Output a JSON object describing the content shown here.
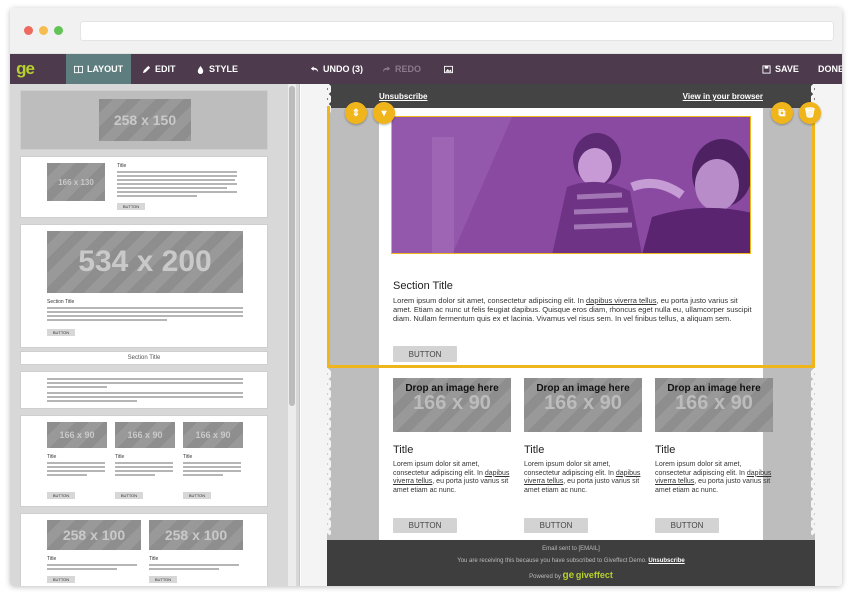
{
  "toolbar": {
    "logo": "ge",
    "layout": "LAYOUT",
    "edit": "EDIT",
    "style": "STYLE",
    "undo": "UNDO (3)",
    "redo": "REDO",
    "save": "SAVE",
    "done": "DONE"
  },
  "blocks": {
    "b1_ph": "258 x 150",
    "b2_ph": "166 x 130",
    "b2_title": "Title",
    "b2_btn": "BUTTON",
    "b3_ph": "534 x 200",
    "b3_title": "Section Title",
    "b3_btn": "BUTTON",
    "b4_title": "Section Title",
    "b6_ph": "166 x 90",
    "b6_title": "Title",
    "b6_btn": "BUTTON",
    "b7_ph": "258 x 100",
    "b7_title": "Title",
    "b7_btn": "BUTTON"
  },
  "email": {
    "unsubscribe": "Unsubscribe",
    "view_browser": "View in your browser",
    "section_title": "Section Title",
    "para_1": "Lorem ipsum dolor sit amet, consectetur adipiscing elit. In ",
    "para_link": "dapibus viverra tellus",
    "para_2": ", eu porta justo varius sit amet. Etiam ac nunc ut felis feugiat dapibus. Quisque eros diam, rhoncus eget nulla eu, ullamcorper suscipit diam. Nullam fermentum quis ex et lacinia. Vivamus vel risus sem. In vel finibus tellus, a aliquam sem.",
    "button": "BUTTON",
    "col_ph": "166 x 90",
    "drop_text": "Drop an image here",
    "col_title": "Title",
    "col_para_1": "Lorem ipsum dolor sit amet, consectetur adipiscing elit. In ",
    "col_para_link": "dapibus viverra tellus",
    "col_para_2": ", eu porta justo varius sit amet etiam ac nunc.",
    "footer_line1": "Email sent to [EMAIL]",
    "footer_line2": "You are receiving this because you have subscribed to Giveffect Demo.",
    "footer_unsub": "Unsubscribe",
    "footer_powered": "Powered by",
    "footer_brand": "giveffect"
  },
  "colors": {
    "toolbar": "#4d3a4d",
    "accent": "#f1b51c",
    "brand_green": "#b6d12e",
    "active_tab": "#5e7d7e"
  }
}
